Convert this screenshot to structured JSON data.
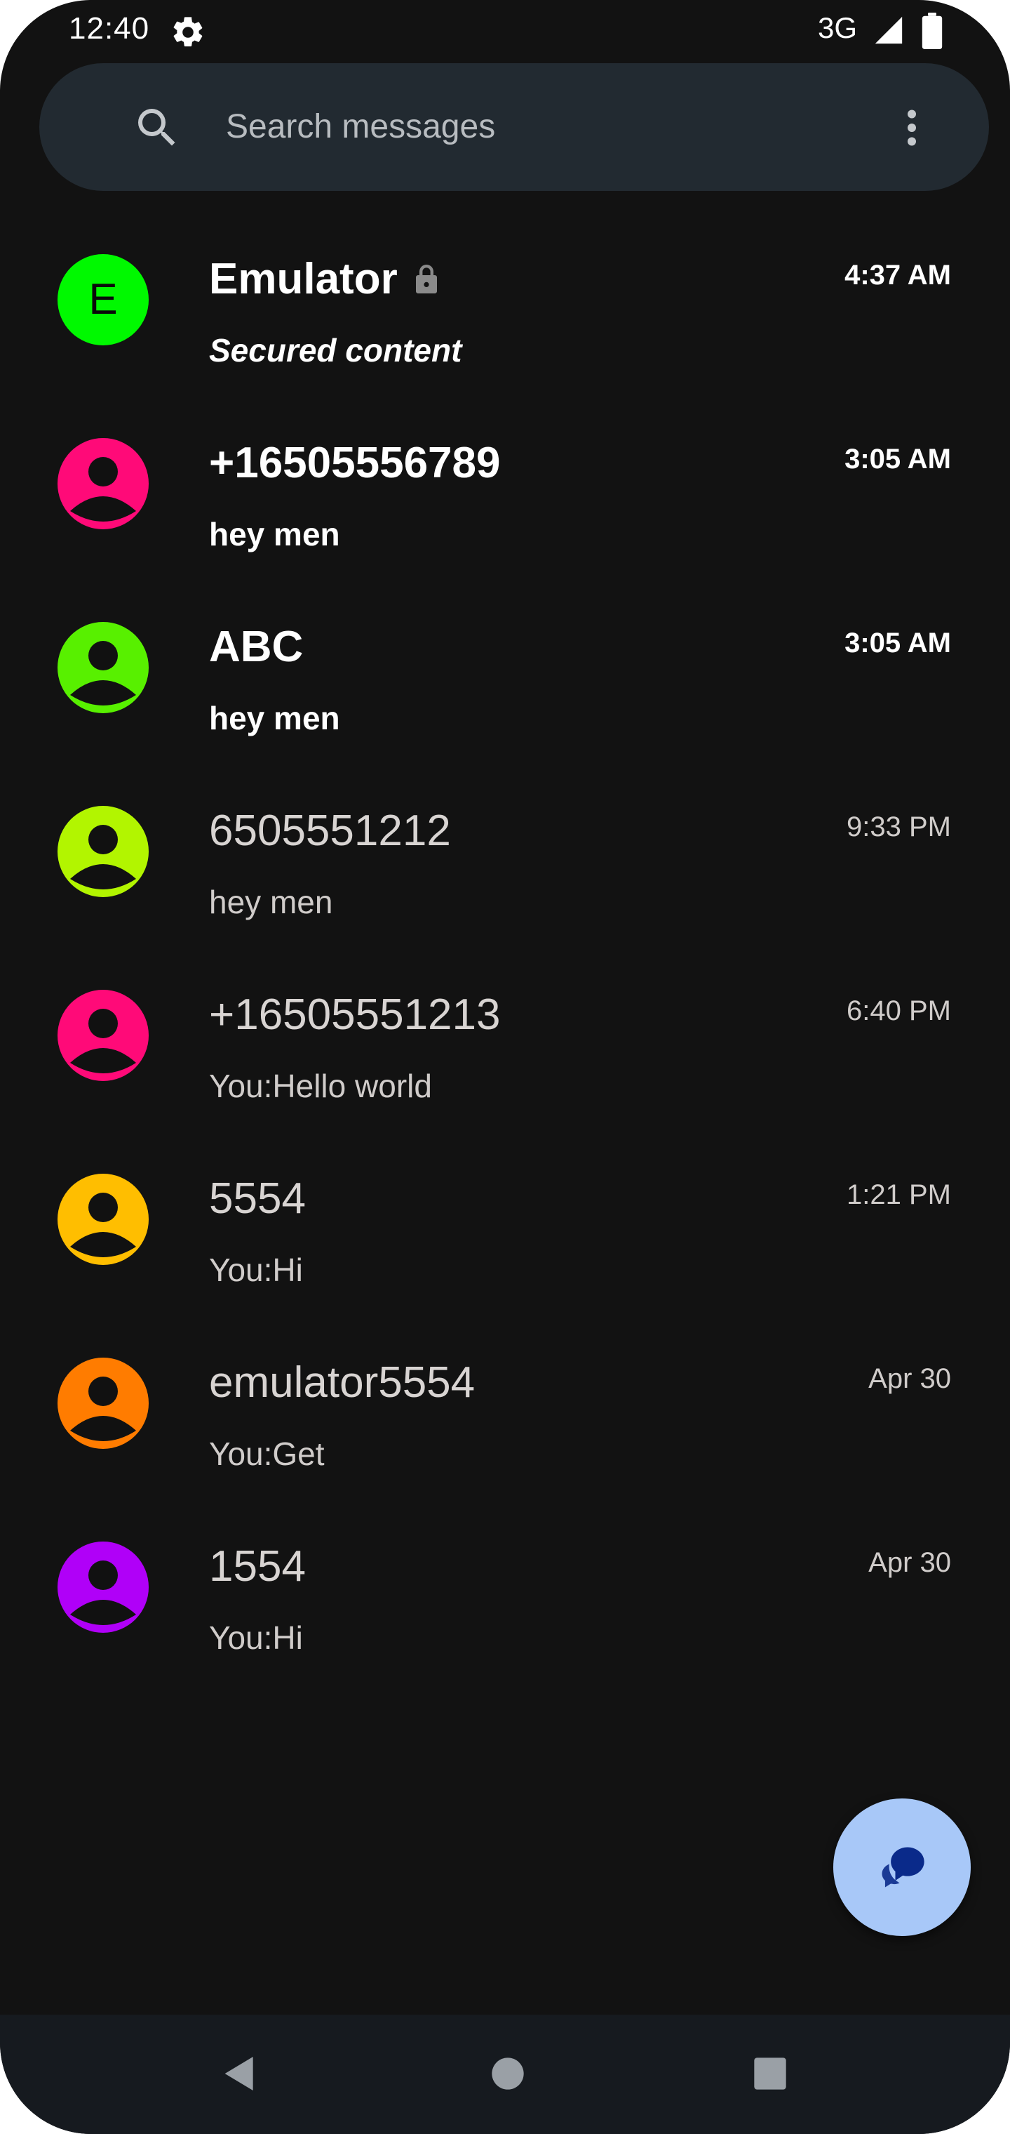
{
  "status_bar": {
    "time": "12:40",
    "network": "3G",
    "icons": [
      "gear-icon",
      "signal-icon",
      "battery-icon"
    ]
  },
  "search": {
    "placeholder": "Search messages",
    "value": ""
  },
  "conversations": [
    {
      "avatar_letter": "E",
      "avatar_color": "#00f900",
      "name": "Emulator",
      "snippet": "Secured content",
      "time": "4:37 AM",
      "unread": true,
      "secure": true
    },
    {
      "avatar_letter": "",
      "avatar_color": "#ff0a78",
      "name": "+16505556789",
      "snippet": "hey men",
      "time": "3:05 AM",
      "unread": true,
      "secure": false
    },
    {
      "avatar_letter": "",
      "avatar_color": "#58f000",
      "name": "ABC",
      "snippet": "hey men",
      "time": "3:05 AM",
      "unread": true,
      "secure": false
    },
    {
      "avatar_letter": "",
      "avatar_color": "#b2f500",
      "name": "6505551212",
      "snippet": "hey men",
      "time": "9:33 PM",
      "unread": false,
      "secure": false
    },
    {
      "avatar_letter": "",
      "avatar_color": "#ff0a78",
      "name": "+16505551213",
      "snippet": "You:Hello world",
      "time": "6:40 PM",
      "unread": false,
      "secure": false
    },
    {
      "avatar_letter": "",
      "avatar_color": "#ffbe00",
      "name": "5554",
      "snippet": "You:Hi",
      "time": "1:21 PM",
      "unread": false,
      "secure": false
    },
    {
      "avatar_letter": "",
      "avatar_color": "#ff7c00",
      "name": "emulator5554",
      "snippet": "You:Get",
      "time": "Apr 30",
      "unread": false,
      "secure": false
    },
    {
      "avatar_letter": "",
      "avatar_color": "#b000f8",
      "name": "1554",
      "snippet": "You:Hi",
      "time": "Apr 30",
      "unread": false,
      "secure": false
    }
  ],
  "fab": {
    "icon": "start-chat-icon",
    "color": "#a8c8f8"
  },
  "nav_bar": {
    "icons": [
      "back-icon",
      "home-icon",
      "recents-icon"
    ]
  },
  "colors": {
    "background": "#121212",
    "search_bar": "#222a31",
    "nav_bar": "#161a1f"
  }
}
